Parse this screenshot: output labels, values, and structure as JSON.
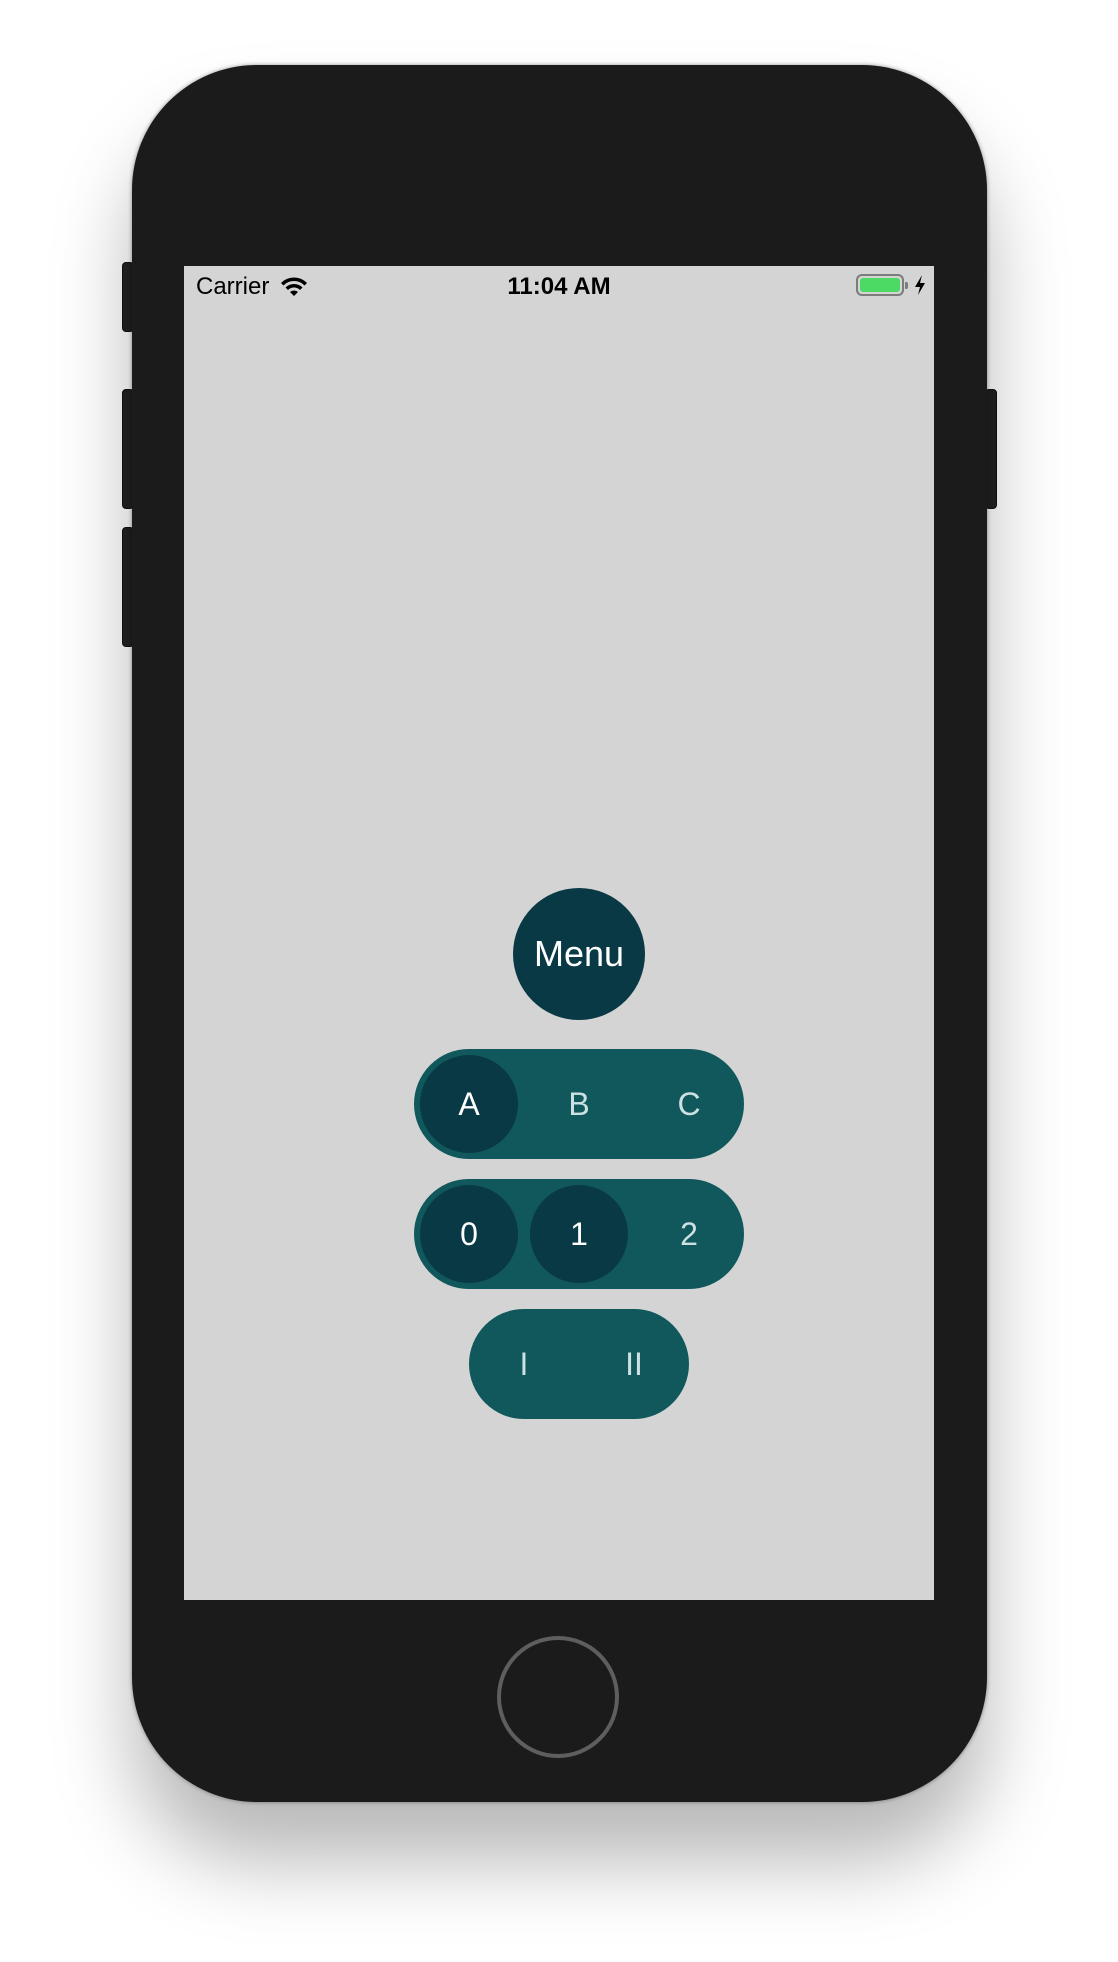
{
  "status_bar": {
    "carrier": "Carrier",
    "time": "11:04 AM",
    "battery_level": 1.0,
    "charging": true,
    "wifi_icon": "wifi-icon",
    "charging_icon": "bolt-icon"
  },
  "menu": {
    "label": "Menu"
  },
  "segments_letters": {
    "items": [
      "A",
      "B",
      "C"
    ],
    "selected": [
      "A"
    ]
  },
  "segments_numbers": {
    "items": [
      "0",
      "1",
      "2"
    ],
    "selected": [
      "0",
      "1"
    ]
  },
  "segments_roman": {
    "items": [
      "I",
      "II"
    ],
    "selected": []
  },
  "colors": {
    "screen_background": "#d4d4d5",
    "menu_button": "#083944",
    "pill_background": "#10585c",
    "segment_selected": "#083944",
    "segment_text": "#cde0e2",
    "battery_fill": "#4cd964",
    "phone_body": "#1b1b1b"
  }
}
